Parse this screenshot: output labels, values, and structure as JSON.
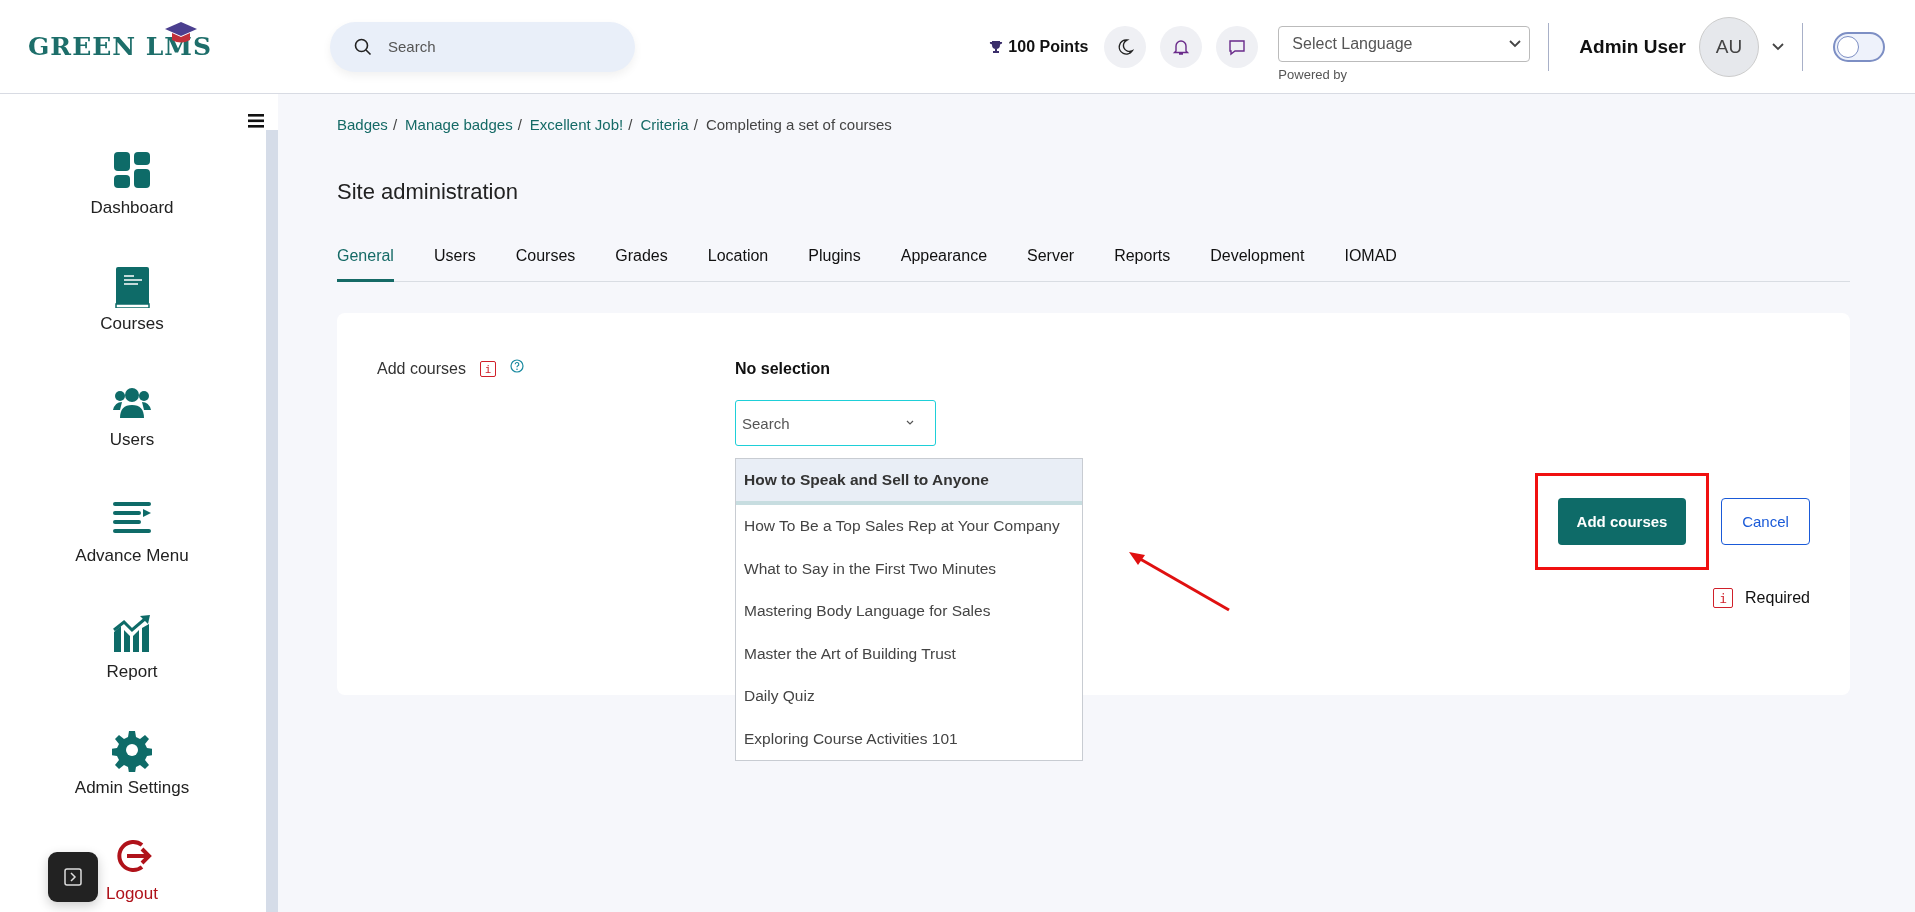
{
  "header": {
    "logo": "GREEN LMS",
    "search": {
      "placeholder": "Search"
    },
    "points": "100 Points",
    "language": {
      "value": "Select Language",
      "note": "Powered by"
    },
    "user": {
      "name": "Admin User",
      "initials": "AU"
    },
    "toggle": {
      "on": false
    }
  },
  "sidebar": {
    "items": [
      {
        "label": "Dashboard",
        "kind": "dashboard"
      },
      {
        "label": "Courses",
        "kind": "book"
      },
      {
        "label": "Users",
        "kind": "users"
      },
      {
        "label": "Advance Menu",
        "kind": "menu"
      },
      {
        "label": "Report",
        "kind": "chart"
      },
      {
        "label": "Admin Settings",
        "kind": "gear"
      },
      {
        "label": "Logout",
        "kind": "logout"
      }
    ]
  },
  "breadcrumb": [
    {
      "label": "Badges",
      "link": true,
      "separator": "/"
    },
    {
      "label": "Manage badges",
      "link": true,
      "separator": "/"
    },
    {
      "label": "Excellent Job!",
      "link": true,
      "separator": "/"
    },
    {
      "label": "Criteria",
      "link": true,
      "separator": "/"
    },
    {
      "label": "Completing a set of courses",
      "link": false
    }
  ],
  "page_title": "Site administration",
  "tabs": [
    {
      "label": "General",
      "selected": true
    },
    {
      "label": "Users",
      "selected": false
    },
    {
      "label": "Courses",
      "selected": false
    },
    {
      "label": "Grades",
      "selected": false
    },
    {
      "label": "Location",
      "selected": false
    },
    {
      "label": "Plugins",
      "selected": false
    },
    {
      "label": "Appearance",
      "selected": false
    },
    {
      "label": "Server",
      "selected": false
    },
    {
      "label": "Reports",
      "selected": false
    },
    {
      "label": "Development",
      "selected": false
    },
    {
      "label": "IOMAD",
      "selected": false
    }
  ],
  "form": {
    "label": "Add courses",
    "required_icon": "i",
    "selection": "No selection",
    "search": {
      "placeholder": "Search"
    },
    "options": [
      {
        "label": "How to Speak and Sell to Anyone",
        "selected": true
      },
      {
        "label": "How To Be a Top Sales Rep at Your Company",
        "selected": false
      },
      {
        "label": "What to Say in the First Two Minutes",
        "selected": false
      },
      {
        "label": "Mastering Body Language for Sales",
        "selected": false
      },
      {
        "label": "Master the Art of Building Trust",
        "selected": false
      },
      {
        "label": "Daily Quiz",
        "selected": false
      },
      {
        "label": "Exploring Course Activities 101",
        "selected": false
      }
    ],
    "buttons": [
      {
        "label": "Add courses",
        "kind": "primary"
      },
      {
        "label": "Cancel",
        "kind": "secondary"
      }
    ],
    "required_legend_icon": "i",
    "required": "Required"
  }
}
